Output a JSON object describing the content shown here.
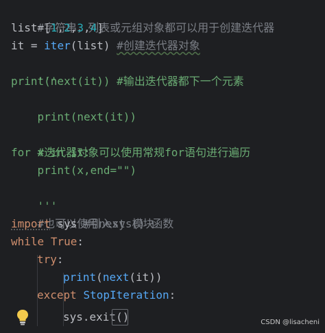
{
  "editor": {
    "lines": [
      {
        "id": "l1",
        "text": "#字符串，列表或元组对象都可以用于创建迭代器"
      },
      {
        "id": "l2",
        "text": "list=[1,2,3,4]"
      },
      {
        "id": "l3",
        "text": "it = iter(list) #创建迭代器对象"
      },
      {
        "id": "l4",
        "text": "'''"
      },
      {
        "id": "l5",
        "text": "print(next(it)) #输出迭代器都下一个元素"
      },
      {
        "id": "l6",
        "text": "print(next(it))"
      },
      {
        "id": "l7",
        "text": ""
      },
      {
        "id": "l8",
        "text": "#迭代器对象可以使用常规for语句进行遍历"
      },
      {
        "id": "l9",
        "text": "for x in it:"
      },
      {
        "id": "l10",
        "text": "    print(x,end=\"\")"
      },
      {
        "id": "l11",
        "text": "'''"
      },
      {
        "id": "l12",
        "text": "#也可以使用next () 函数"
      },
      {
        "id": "l13",
        "text": "import sys #引入sys模块"
      },
      {
        "id": "l14",
        "text": "while True:"
      },
      {
        "id": "l15",
        "text": "    try:"
      },
      {
        "id": "l16",
        "text": "        print(next(it))"
      },
      {
        "id": "l17",
        "text": "    except StopIteration:"
      },
      {
        "id": "l18",
        "text": "        sys.exit()"
      }
    ]
  },
  "tokens": {
    "l1": "#字符串，列表或元组对象都可以用于创建迭代器",
    "l2_a": "list=[",
    "l2_1": "1",
    "l2_c1": ",",
    "l2_2": "2",
    "l2_c2": ",",
    "l2_3": "3",
    "l2_c3": ",",
    "l2_4": "4",
    "l2_b": "]",
    "l3_a": "it = ",
    "l3_fn": "iter",
    "l3_b": "(list) ",
    "l3_c": "#创建迭代器对象",
    "l4": "'''",
    "l5_a": "print(next(it)) ",
    "l5_c": "#输出迭代器都下一个元素",
    "l6": "print(next(it))",
    "l8": "#迭代器对象可以使用常规for语句进行遍历",
    "l9_kw1": "for",
    "l9_a": " x ",
    "l9_kw2": "in",
    "l9_b": " it:",
    "l10_a": "    print(x,end=",
    "l10_s": "\"\"",
    "l10_b": ")",
    "l11": "'''",
    "l12": "#也可以使用next () 函数",
    "l13_kw": "import",
    "l13_a": " sys ",
    "l13_c": "#引入sys模块",
    "l14_kw": "while",
    "l14_sp": " ",
    "l14_kw2": "True",
    "l14_b": ":",
    "l15_kw": "try",
    "l15_b": ":",
    "l16_fn": "print",
    "l16_a": "(",
    "l16_fn2": "next",
    "l16_b": "(it))",
    "l17_kw": "except",
    "l17_sp": " ",
    "l17_cls": "StopIteration",
    "l17_b": ":",
    "l18_a": "sys.exit",
    "l18_b": "()"
  },
  "watermark": "CSDN @lisacheni",
  "icons": {
    "bulb": "lightbulb-icon"
  },
  "colors": {
    "background": "#1e1f22",
    "comment": "#7a7e85",
    "docstring": "#6aab73",
    "keyword": "#cf8e6d",
    "number": "#2aacb8",
    "function": "#56a8f5",
    "text": "#bcbec4"
  }
}
